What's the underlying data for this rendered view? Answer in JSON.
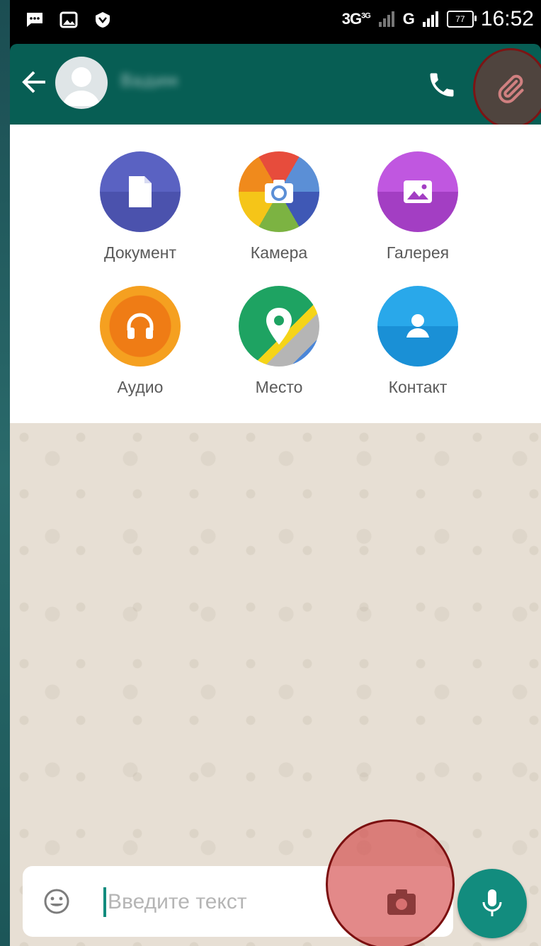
{
  "status_bar": {
    "network_1": "3G",
    "network_1_sup": "3G",
    "network_2": "G",
    "battery": "77",
    "time": "16:52",
    "left_icons": [
      "message-icon",
      "image-icon",
      "shield-icon"
    ]
  },
  "app_bar": {
    "contact_name": "Вадим",
    "icons": [
      "back-arrow-icon",
      "avatar-icon",
      "phone-icon",
      "paperclip-icon"
    ],
    "color": "#075e54"
  },
  "attach_panel": {
    "items": [
      {
        "label": "Документ",
        "icon": "document-icon",
        "color": "#5157ae"
      },
      {
        "label": "Камера",
        "icon": "camera-icon",
        "color": "#f39c12"
      },
      {
        "label": "Галерея",
        "icon": "gallery-icon",
        "color": "#ac44cf"
      },
      {
        "label": "Аудио",
        "icon": "headphones-icon",
        "color": "#f07f13"
      },
      {
        "label": "Место",
        "icon": "location-pin-icon",
        "color": "#1ea362"
      },
      {
        "label": "Контакт",
        "icon": "person-icon",
        "color": "#1e9ae0"
      }
    ]
  },
  "composer": {
    "placeholder": "Введите текст",
    "icons": [
      "emoji-icon",
      "camera-icon",
      "microphone-icon"
    ],
    "accent": "#128c7e"
  }
}
